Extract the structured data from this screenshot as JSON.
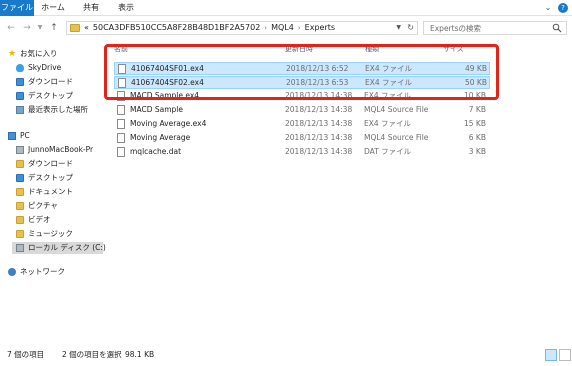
{
  "ribbon": {
    "tabs": [
      "ファイル",
      "ホーム",
      "共有",
      "表示"
    ],
    "accent": "#1979ca"
  },
  "address": {
    "root_glyph": "«",
    "crumbs": [
      "50CA3DFB510CC5A8F28B48D1BF2A5702",
      "MQL4",
      "Experts"
    ],
    "search_placeholder": "Expertsの検索"
  },
  "nav": {
    "favorites": "お気に入り",
    "skydrive": "SkyDrive",
    "downloads_fav": "ダウンロード",
    "desktop_fav": "デスクトップ",
    "recent": "最近表示した場所",
    "pc": "PC",
    "junno": "JunnoMacBook-Pr",
    "downloads": "ダウンロード",
    "desktop": "デスクトップ",
    "documents": "ドキュメント",
    "pictures": "ピクチャ",
    "videos": "ビデオ",
    "music": "ミュージック",
    "local_disk": "ローカル ディスク (C:)",
    "network": "ネットワーク"
  },
  "list": {
    "headers": {
      "name": "名前",
      "date": "更新日時",
      "type": "種類",
      "size": "サイズ"
    },
    "rows": [
      {
        "name": "41067404SF01.ex4",
        "date": "2018/12/13 6:52",
        "type": "EX4 ファイル",
        "size": "49 KB"
      },
      {
        "name": "41067404SF02.ex4",
        "date": "2018/12/13 6:53",
        "type": "EX4 ファイル",
        "size": "50 KB"
      },
      {
        "name": "MACD Sample.ex4",
        "date": "2018/12/13 14:38",
        "type": "EX4 ファイル",
        "size": "10 KB"
      },
      {
        "name": "MACD Sample",
        "date": "2018/12/13 14:38",
        "type": "MQL4 Source File",
        "size": "7 KB"
      },
      {
        "name": "Moving Average.ex4",
        "date": "2018/12/13 14:38",
        "type": "EX4 ファイル",
        "size": "15 KB"
      },
      {
        "name": "Moving Average",
        "date": "2018/12/13 14:38",
        "type": "MQL4 Source File",
        "size": "6 KB"
      },
      {
        "name": "mqlcache.dat",
        "date": "2018/12/13 14:38",
        "type": "DAT ファイル",
        "size": "3 KB"
      }
    ]
  },
  "status": {
    "item_count": "7 個の項目",
    "selection": "2 個の項目を選択",
    "selection_size": "98.1 KB"
  }
}
